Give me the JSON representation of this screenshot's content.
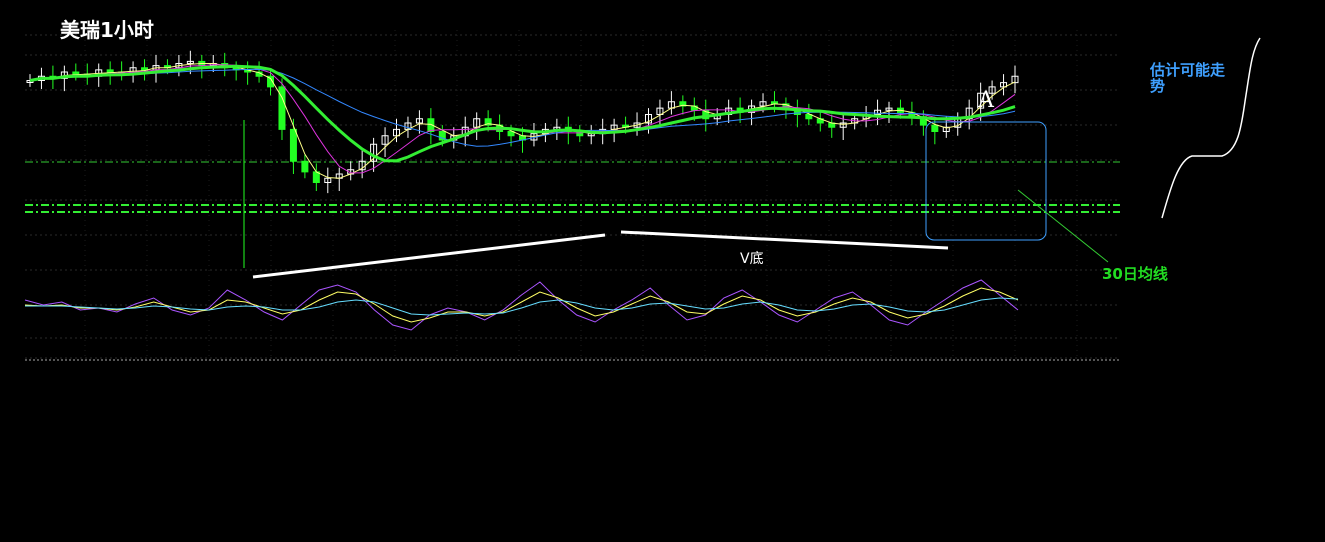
{
  "title": "美瑞1小时",
  "annotations": {
    "box_label": "A",
    "estimate": "估计可能走势",
    "v_bottom": "V底",
    "ma_label": "30日均线"
  },
  "colors": {
    "background": "#000000",
    "candle_up": "#ffffff",
    "candle_down": "#22ff22",
    "ma_short": "#ffff88",
    "ma_mid": "#dd33dd",
    "ma_long": "#3388ff",
    "ma_30": "#33ee33",
    "box": "#3fa0ff",
    "osc_1": "#aa55ff",
    "osc_2": "#ffff66",
    "osc_3": "#66ddff"
  },
  "chart_data": {
    "type": "candlestick",
    "title": "美瑞1小时",
    "price_close_index": [
      68,
      70,
      69,
      72,
      71,
      70,
      73,
      72,
      71,
      74,
      73,
      75,
      74,
      76,
      77,
      75,
      76,
      74,
      73,
      72,
      70,
      65,
      45,
      30,
      25,
      20,
      22,
      24,
      26,
      30,
      38,
      42,
      45,
      48,
      50,
      44,
      40,
      42,
      46,
      50,
      47,
      44,
      42,
      40,
      43,
      45,
      46,
      44,
      42,
      43,
      45,
      47,
      46,
      48,
      52,
      55,
      58,
      56,
      54,
      50,
      52,
      55,
      53,
      56,
      58,
      57,
      55,
      52,
      50,
      48,
      46,
      48,
      50,
      52,
      54,
      55,
      53,
      51,
      47,
      44,
      46,
      50,
      55,
      62,
      65,
      67,
      70
    ],
    "oscillator": {
      "series_1": [
        60,
        55,
        58,
        50,
        52,
        48,
        56,
        62,
        50,
        45,
        52,
        70,
        60,
        48,
        40,
        55,
        70,
        75,
        68,
        50,
        35,
        30,
        45,
        52,
        48,
        40,
        50,
        65,
        78,
        60,
        45,
        38,
        50,
        60,
        72,
        55,
        40,
        45,
        62,
        70,
        58,
        45,
        38,
        50,
        62,
        68,
        55,
        40,
        35,
        48,
        60,
        72,
        80,
        65,
        50
      ],
      "series_2": [
        55,
        54,
        55,
        52,
        52,
        50,
        53,
        58,
        53,
        48,
        50,
        60,
        58,
        52,
        46,
        50,
        60,
        68,
        66,
        56,
        44,
        38,
        42,
        48,
        48,
        44,
        48,
        58,
        68,
        62,
        52,
        44,
        48,
        56,
        64,
        58,
        48,
        46,
        56,
        64,
        60,
        50,
        44,
        48,
        56,
        62,
        58,
        48,
        42,
        46,
        54,
        64,
        72,
        68,
        60
      ],
      "series_3": [
        54,
        54,
        54,
        53,
        52,
        51,
        52,
        54,
        53,
        51,
        50,
        53,
        54,
        53,
        50,
        50,
        53,
        58,
        60,
        58,
        52,
        46,
        45,
        46,
        47,
        46,
        47,
        52,
        58,
        60,
        57,
        52,
        50,
        52,
        56,
        57,
        54,
        51,
        52,
        56,
        58,
        55,
        50,
        49,
        51,
        55,
        56,
        53,
        49,
        48,
        50,
        55,
        60,
        62,
        61
      ]
    }
  }
}
